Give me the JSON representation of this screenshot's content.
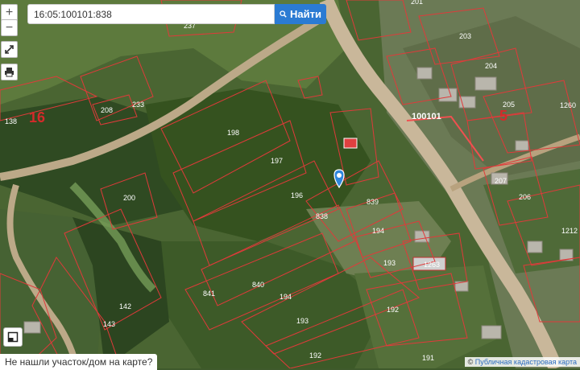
{
  "search": {
    "value": "16:05:100101:838",
    "button_label": "Найти",
    "search_icon": "magnifier"
  },
  "controls": {
    "zoom_in": "+",
    "zoom_out": "−",
    "fullscreen_icon": "expand-arrows",
    "print_icon": "printer",
    "layers_icon": "layers"
  },
  "hint": "Не нашли участок/дом на карте?",
  "attribution": {
    "symbol": "©",
    "text": "Публичная кадастровая карта"
  },
  "map": {
    "quarter_labels": [
      "16",
      "5"
    ],
    "block_label": "100101",
    "parcel_labels": [
      "201",
      "203",
      "204",
      "205",
      "237",
      "208",
      "233",
      "138",
      "198",
      "197",
      "196",
      "200",
      "838",
      "839",
      "194",
      "193",
      "192",
      "191",
      "840",
      "841",
      "142",
      "143",
      "207",
      "206",
      "1263",
      "1260",
      "1212"
    ],
    "marker_color": "#2e86de",
    "boundary_color": "#e03a3a"
  }
}
